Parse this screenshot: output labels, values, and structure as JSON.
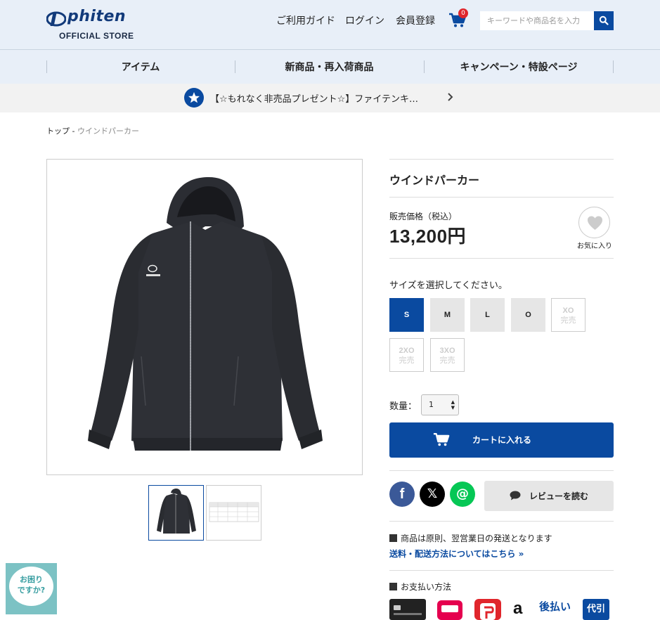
{
  "header": {
    "logo_text": "phiten",
    "logo_sub": "OFFICIAL STORE",
    "nav": [
      "ご利用ガイド",
      "ログイン",
      "会員登録"
    ],
    "cart_count": "0",
    "search_placeholder": "キーワードや商品名を入力"
  },
  "category_nav": [
    "アイテム",
    "新商品・再入荷商品",
    "キャンペーン・特設ページ"
  ],
  "banner": {
    "text": "【☆もれなく非売品プレゼント☆】ファイテンキ…"
  },
  "breadcrumb": {
    "home": "トップ",
    "sep": " - ",
    "current": "ウインドパーカー"
  },
  "product": {
    "title": "ウインドパーカー",
    "price_label": "販売価格（税込）",
    "price": "13,200円",
    "favorite_label": "お気に入り",
    "size_prompt": "サイズを選択してください。",
    "sizes": [
      {
        "label": "S",
        "state": "selected"
      },
      {
        "label": "M",
        "state": "available"
      },
      {
        "label": "L",
        "state": "available"
      },
      {
        "label": "O",
        "state": "available"
      },
      {
        "label": "XO",
        "state": "soldout"
      },
      {
        "label": "2XO",
        "state": "soldout"
      },
      {
        "label": "3XO",
        "state": "soldout"
      }
    ],
    "soldout_label": "完売",
    "quantity_label": "数量：",
    "quantity_value": "1",
    "cart_button": "カートに入れる",
    "review_button": "レビューを読む"
  },
  "shipping": {
    "note": "商品は原則、翌営業日の発送となります",
    "link": "送料・配送方法についてはこちら »"
  },
  "payment": {
    "title": "お支払い方法",
    "amazon": "a",
    "atobarai": "後払い",
    "daibiki": "代引"
  },
  "help": {
    "line1": "お困り",
    "line2": "ですか?"
  },
  "colors": {
    "brand_blue": "#0a4aa0",
    "header_bg": "#e8eff8"
  }
}
